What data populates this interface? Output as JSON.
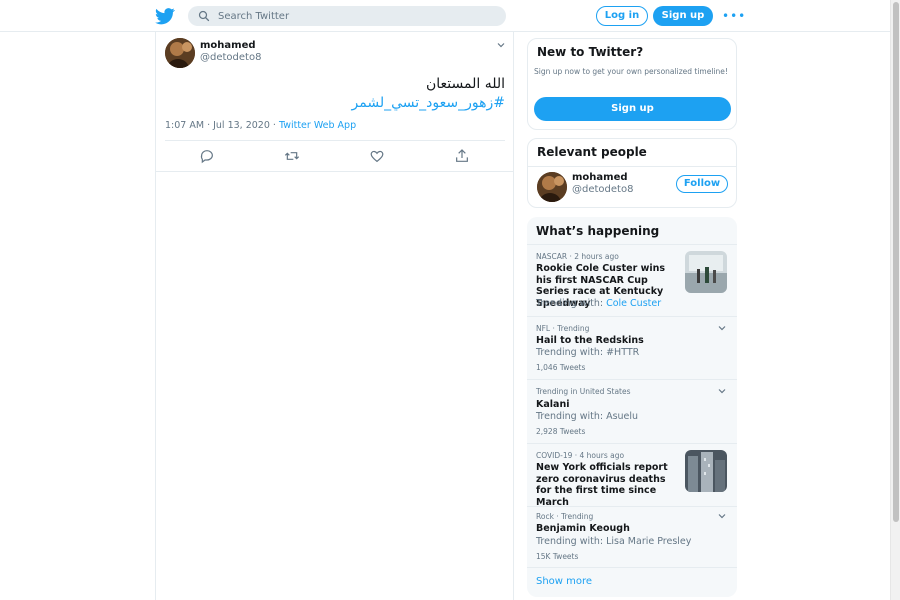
{
  "header": {
    "search_placeholder": "Search Twitter",
    "login_label": "Log in",
    "signup_label": "Sign up",
    "more_icon": "more-horizontal-icon",
    "logo_icon": "twitter-bird-icon"
  },
  "tweet": {
    "author_name": "mohamed",
    "author_handle": "@detodeto8",
    "text_line1": "الله المستعان",
    "text_line2": "#زهور_سعود_تسي_لشمر",
    "timestamp": "1:07 AM · Jul 13, 2020 · ",
    "source_app": "Twitter Web App",
    "actions": [
      "reply-icon",
      "retweet-icon",
      "like-icon",
      "share-icon"
    ]
  },
  "sidebar": {
    "new_to_twitter": {
      "title": "New to Twitter?",
      "description": "Sign up now to get your own personalized timeline!",
      "signup_label": "Sign up"
    },
    "relevant_people": {
      "title": "Relevant people",
      "name": "mohamed",
      "handle": "@detodeto8",
      "follow_label": "Follow"
    },
    "whats_happening": {
      "title": "What’s happening",
      "trends": [
        {
          "context": "NASCAR · 2 hours ago",
          "name": "Rookie Cole Custer wins his first NASCAR Cup Series race at Kentucky Speedway",
          "sub_prefix": "Trending with: ",
          "sub_link": "Cole Custer",
          "count": ""
        },
        {
          "context": "NFL · Trending",
          "name": "Hail to the Redskins",
          "sub_prefix": "Trending with: #HTTR",
          "sub_link": "",
          "count": "1,046 Tweets"
        },
        {
          "context": "Trending in United States",
          "name": "Kalani",
          "sub_prefix": "Trending with: Asuelu",
          "sub_link": "",
          "count": "2,928 Tweets"
        },
        {
          "context": "COVID-19 · 4 hours ago",
          "name": "New York officials report zero coronavirus deaths for the first time since March",
          "sub_prefix": "",
          "sub_link": "",
          "count": ""
        },
        {
          "context": "Rock · Trending",
          "name": "Benjamin Keough",
          "sub_prefix": "Trending with: Lisa Marie Presley",
          "sub_link": "",
          "count": "15K Tweets"
        }
      ],
      "show_more_label": "Show more"
    }
  },
  "colors": {
    "accent": "#1da1f2",
    "text_primary": "#14171a",
    "text_secondary": "#657786",
    "border": "#e6ecf0",
    "trends_bg": "#f5f8fa"
  }
}
